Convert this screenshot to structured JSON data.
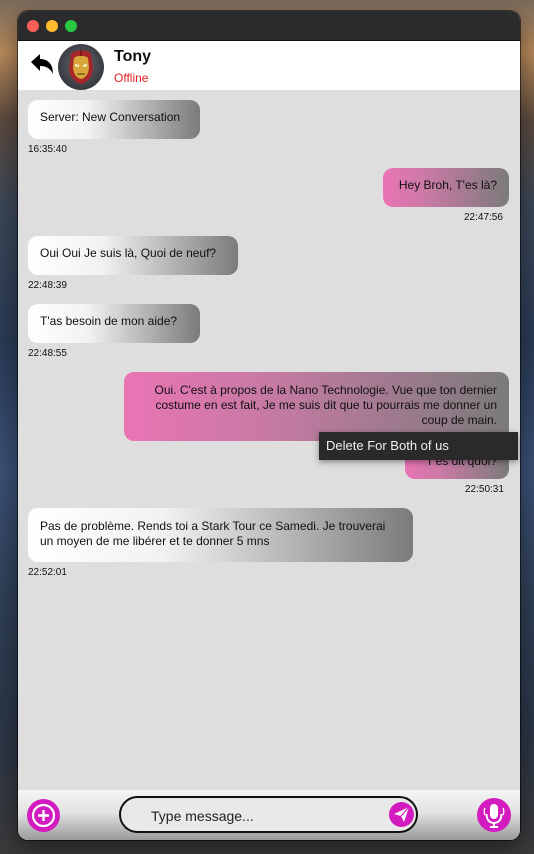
{
  "window": {
    "controls": [
      "close",
      "minimize",
      "maximize"
    ]
  },
  "header": {
    "back_icon": "reply-arrow-icon",
    "avatar_icon": "iron-man-helmet-avatar",
    "name": "Tony",
    "status": "Offline",
    "status_color": "#e02020"
  },
  "messages": [
    {
      "direction": "in",
      "text": "Server: New Conversation",
      "time": "16:35:40"
    },
    {
      "direction": "out",
      "text": "Hey Broh, T'es là?",
      "time": "22:47:56"
    },
    {
      "direction": "in",
      "text": "Oui Oui Je suis là, Quoi de neuf?",
      "time": "22:48:39"
    },
    {
      "direction": "in",
      "text": "T'as besoin de mon aide?",
      "time": "22:48:55"
    },
    {
      "direction": "out",
      "text": "Oui. C'est à propos de la Nano Technologie. Vue que ton dernier costume en est fait, Je me suis dit que tu pourrais me donner un coup de main.",
      "time": ""
    },
    {
      "direction": "out",
      "text": "T'es dit quoi?",
      "time": "22:50:31"
    },
    {
      "direction": "in",
      "text": "Pas de problème. Rends toi a Stark Tour ce Samedi. Je trouverai un moyen de me libérer et te donner 5 mns",
      "time": "22:52:01"
    }
  ],
  "context_menu": {
    "item": "Delete For Both of us"
  },
  "composer": {
    "add_icon": "plus-circle-icon",
    "placeholder": "Type message...",
    "value": "",
    "send_icon": "paper-plane-icon",
    "mic_icon": "microphone-icon",
    "accent": "#d21cc0"
  }
}
